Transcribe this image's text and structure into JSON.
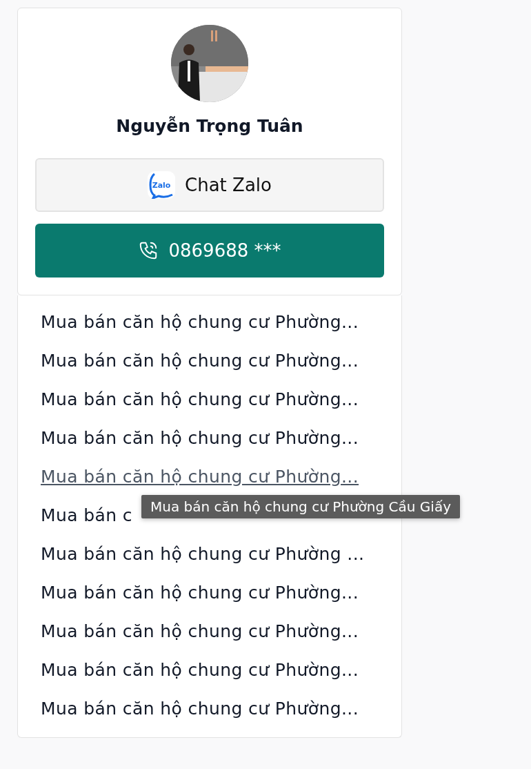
{
  "agent": {
    "name": "Nguyễn Trọng Tuân"
  },
  "buttons": [
    {
      "kind": "zalo",
      "label": "Chat Zalo",
      "icon_text": "Zalo"
    },
    {
      "kind": "phone",
      "label": "0869688 ***"
    }
  ],
  "links": [
    {
      "text": "Mua bán căn hộ chung cư Phường...",
      "hovered": false
    },
    {
      "text": "Mua bán căn hộ chung cư Phường...",
      "hovered": false
    },
    {
      "text": "Mua bán căn hộ chung cư Phường...",
      "hovered": false
    },
    {
      "text": "Mua bán căn hộ chung cư Phường...",
      "hovered": false
    },
    {
      "text": "Mua bán căn hộ chung cư Phường...",
      "hovered": true
    },
    {
      "text": "Mua bán c",
      "hovered": false
    },
    {
      "text": "Mua bán căn hộ chung cư Phường ...",
      "hovered": false
    },
    {
      "text": "Mua bán căn hộ chung cư Phường...",
      "hovered": false
    },
    {
      "text": "Mua bán căn hộ chung cư Phường...",
      "hovered": false
    },
    {
      "text": "Mua bán căn hộ chung cư Phường...",
      "hovered": false
    },
    {
      "text": "Mua bán căn hộ chung cư Phường...",
      "hovered": false
    }
  ],
  "tooltip": {
    "text": "Mua bán căn hộ chung cư Phường Cầu Giấy"
  }
}
